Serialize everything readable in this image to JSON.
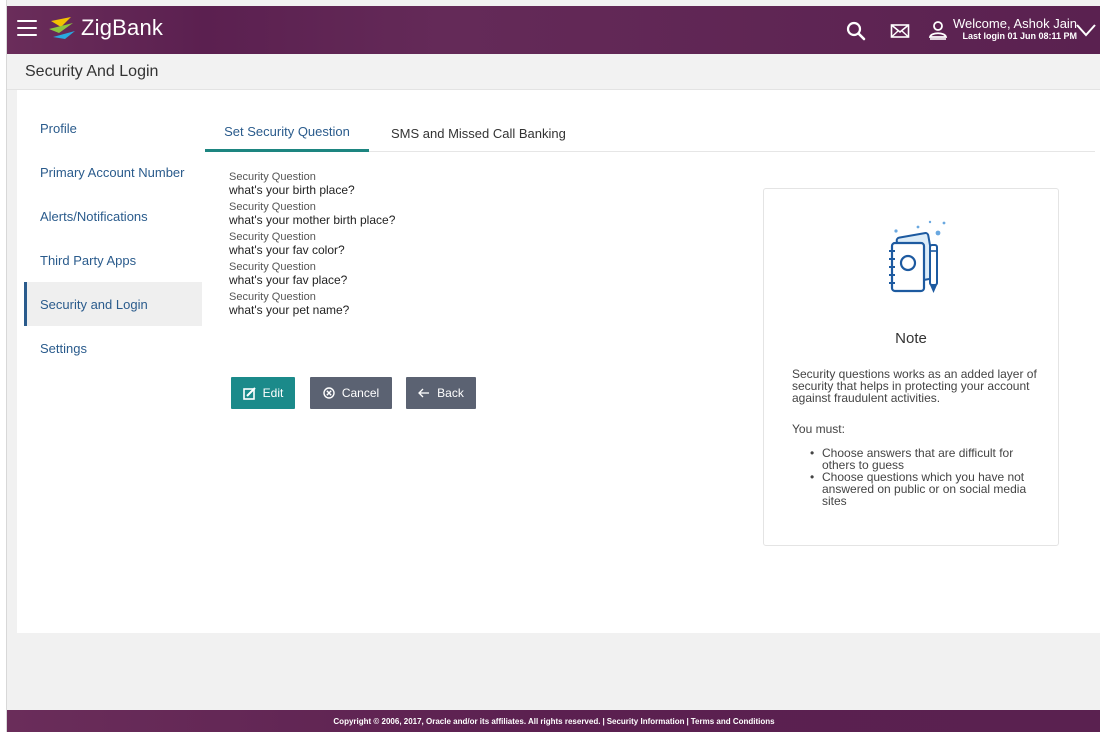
{
  "header": {
    "brand": "ZigBank",
    "welcome": "Welcome, Ashok Jain",
    "last_login": "Last login 01 Jun 08:11 PM",
    "icons": [
      "menu-icon",
      "search-icon",
      "mail-icon",
      "user-icon",
      "chevron-down-icon"
    ],
    "colors": {
      "bar": "#5b2050",
      "accent": "#1b8a8a",
      "link": "#2a5b8c"
    }
  },
  "page": {
    "title": "Security And Login"
  },
  "sidebar": {
    "items": [
      {
        "label": "Profile"
      },
      {
        "label": "Primary Account Number"
      },
      {
        "label": "Alerts/Notifications"
      },
      {
        "label": "Third Party Apps"
      },
      {
        "label": "Security and Login"
      },
      {
        "label": "Settings"
      }
    ],
    "active_index": 4
  },
  "tabs": [
    {
      "label": "Set Security Question"
    },
    {
      "label": "SMS and Missed Call Banking"
    }
  ],
  "questions": [
    {
      "label": "Security Question",
      "value": "what's your birth place?"
    },
    {
      "label": "Security Question",
      "value": "what's your mother birth place?"
    },
    {
      "label": "Security Question",
      "value": "what's your fav color?"
    },
    {
      "label": "Security Question",
      "value": "what's your fav place?"
    },
    {
      "label": "Security Question",
      "value": "what's your pet name?"
    }
  ],
  "buttons": {
    "edit": "Edit",
    "cancel": "Cancel",
    "back": "Back"
  },
  "note": {
    "title": "Note",
    "text": "Security questions works as an added layer of security that helps in protecting your account against fraudulent activities.",
    "must": "You must:",
    "points": [
      "Choose answers that are difficult for others to guess",
      "Choose questions which you have not answered on public or on social media sites"
    ]
  },
  "footer": {
    "copyright": "Copyright © 2006, 2017, Oracle and/or its affiliates. All rights reserved.",
    "separator": "|",
    "security_info": "Security Information",
    "terms": "Terms and Conditions"
  }
}
